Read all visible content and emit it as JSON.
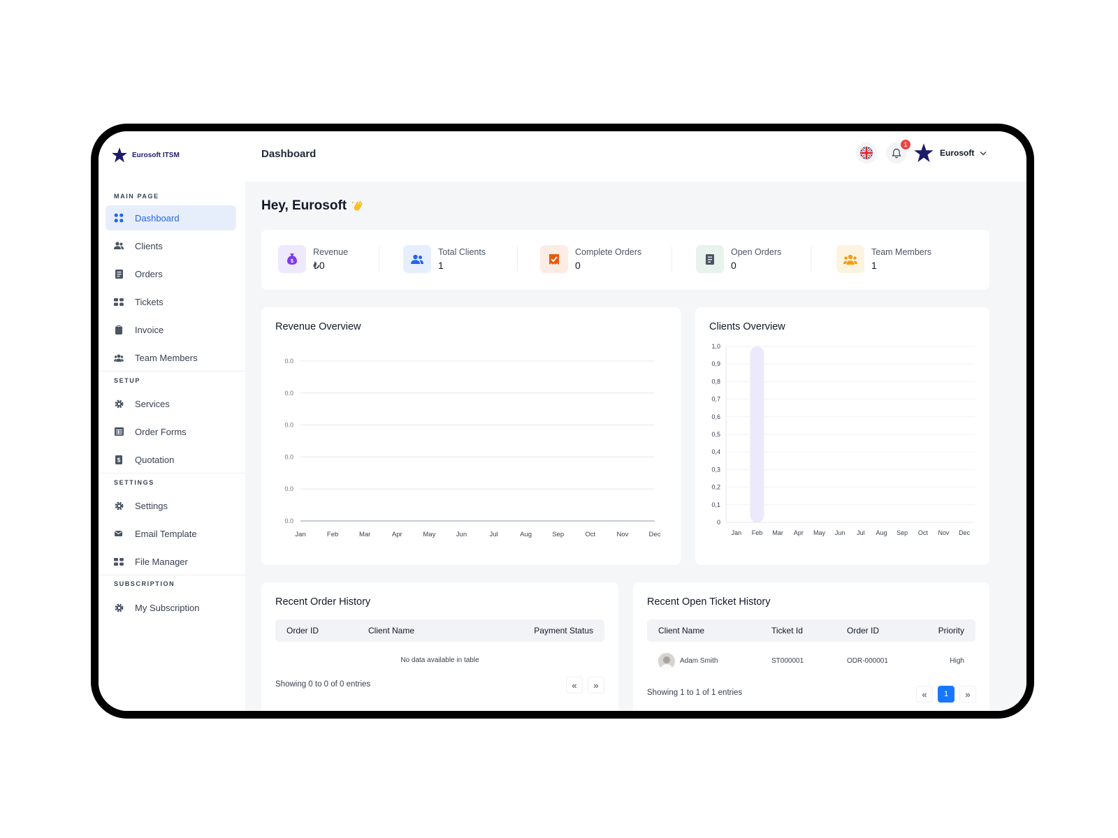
{
  "brand": {
    "name": "Eurosoft ITSM"
  },
  "header": {
    "title": "Dashboard",
    "notification_count": "1",
    "user_name": "Eurosoft"
  },
  "greeting": "Hey, Eurosoft",
  "sidebar": {
    "sections": [
      {
        "title": "MAIN PAGE",
        "items": [
          {
            "label": "Dashboard",
            "icon": "grid-icon",
            "active": true
          },
          {
            "label": "Clients",
            "icon": "users-icon"
          },
          {
            "label": "Orders",
            "icon": "document-icon"
          },
          {
            "label": "Tickets",
            "icon": "ticket-icon"
          },
          {
            "label": "Invoice",
            "icon": "clipboard-icon"
          },
          {
            "label": "Team Members",
            "icon": "team-icon"
          }
        ]
      },
      {
        "title": "SETUP",
        "items": [
          {
            "label": "Services",
            "icon": "gear-icon"
          },
          {
            "label": "Order Forms",
            "icon": "table-icon"
          },
          {
            "label": "Quotation",
            "icon": "quote-icon"
          }
        ]
      },
      {
        "title": "SETTINGS",
        "items": [
          {
            "label": "Settings",
            "icon": "gear-icon"
          },
          {
            "label": "Email Template",
            "icon": "mail-icon"
          },
          {
            "label": "File Manager",
            "icon": "folder-icon"
          }
        ]
      },
      {
        "title": "SUBSCRIPTION",
        "items": [
          {
            "label": "My Subscription",
            "icon": "gear-icon"
          }
        ]
      }
    ]
  },
  "stats": [
    {
      "label": "Revenue",
      "value": "₺0",
      "icon": "money-bag-icon",
      "color": "#7c3aed",
      "bg": "#efe9fd"
    },
    {
      "label": "Total Clients",
      "value": "1",
      "icon": "users-icon",
      "color": "#2563eb",
      "bg": "#e5efff"
    },
    {
      "label": "Complete Orders",
      "value": "0",
      "icon": "check-order-icon",
      "color": "#ea580c",
      "bg": "#fdece4"
    },
    {
      "label": "Open Orders",
      "value": "0",
      "icon": "document-icon",
      "color": "#4b5563",
      "bg": "#e7f3ec"
    },
    {
      "label": "Team Members",
      "value": "1",
      "icon": "team-icon",
      "color": "#f59e0b",
      "bg": "#fdf3e1"
    }
  ],
  "revenue_chart": {
    "title": "Revenue Overview"
  },
  "clients_chart": {
    "title": "Clients Overview"
  },
  "chart_data": [
    {
      "type": "line",
      "title": "Revenue Overview",
      "categories": [
        "Jan",
        "Feb",
        "Mar",
        "Apr",
        "May",
        "Jun",
        "Jul",
        "Aug",
        "Sep",
        "Oct",
        "Nov",
        "Dec"
      ],
      "y_tick_labels": [
        "0.0",
        "0.0",
        "0.0",
        "0.0",
        "0.0",
        "0.0"
      ],
      "series": [
        {
          "values": [
            0,
            0,
            0,
            0,
            0,
            0,
            0,
            0,
            0,
            0,
            0,
            0
          ]
        }
      ],
      "grid": true
    },
    {
      "type": "bar",
      "title": "Clients Overview",
      "categories": [
        "Jan",
        "Feb",
        "Mar",
        "Apr",
        "May",
        "Jun",
        "Jul",
        "Aug",
        "Sep",
        "Oct",
        "Nov",
        "Dec"
      ],
      "values": [
        0,
        1,
        0,
        0,
        0,
        0,
        0,
        0,
        0,
        0,
        0,
        0
      ],
      "y_tick_labels": [
        "1,0",
        "0,9",
        "0,8",
        "0,7",
        "0,6",
        "0,5",
        "0,4",
        "0,3",
        "0,2",
        "0,1",
        "0"
      ],
      "ylim": [
        0,
        1
      ],
      "bar_color": "#ece9fc",
      "grid": true
    }
  ],
  "orders": {
    "title": "Recent Order History",
    "columns": [
      "Order ID",
      "Client Name",
      "Payment Status"
    ],
    "empty_text": "No data available in table",
    "footer": "Showing 0 to 0 of 0 entries",
    "prev": "«",
    "next": "»"
  },
  "tickets": {
    "title": "Recent Open Ticket History",
    "columns": [
      "Client Name",
      "Ticket Id",
      "Order ID",
      "Priority"
    ],
    "rows": [
      {
        "client": "Adam Smith",
        "ticket_id": "ST000001",
        "order_id": "ODR-000001",
        "priority": "High"
      }
    ],
    "footer": "Showing 1 to 1 of 1 entries",
    "prev": "«",
    "page": "1",
    "next": "»"
  },
  "colors": {
    "accent": "#2563eb",
    "brand": "#1e1b6b",
    "badge": "#ef4444"
  }
}
